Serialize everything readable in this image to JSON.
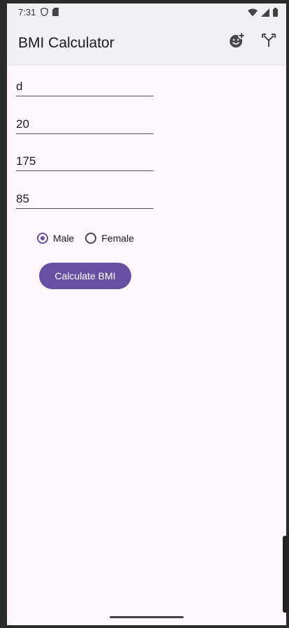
{
  "status_bar": {
    "time": "7:31",
    "left_icons": [
      "shield-icon",
      "sd-card-icon"
    ],
    "right_icons": [
      "wifi-icon",
      "signal-icon",
      "battery-icon"
    ]
  },
  "app_bar": {
    "title": "BMI Calculator",
    "actions": [
      "add-reaction-icon",
      "merge-icon"
    ]
  },
  "form": {
    "field1_value": "d",
    "field2_value": "20",
    "field3_value": "175",
    "field4_value": "85",
    "gender_options": [
      "Male",
      "Female"
    ],
    "selected_gender": "Male",
    "calculate_label": "Calculate BMI"
  },
  "colors": {
    "accent": "#6750a4",
    "background": "#fdf7fd",
    "app_bar": "#f2eff5"
  }
}
